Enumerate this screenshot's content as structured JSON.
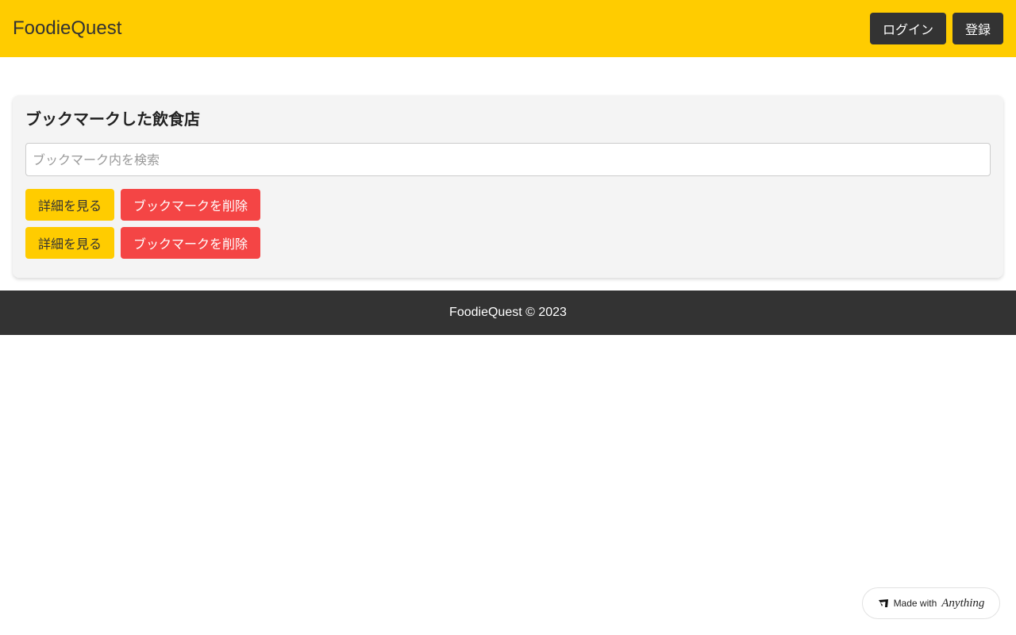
{
  "header": {
    "brand": "FoodieQuest",
    "login_label": "ログイン",
    "register_label": "登録",
    "background_color": "#ffcc00"
  },
  "bookmarks": {
    "title": "ブックマークした飲食店",
    "search_placeholder": "ブックマーク内を検索",
    "search_value": "",
    "rows": [
      {
        "view_label": "詳細を見る",
        "remove_label": "ブックマークを削除"
      },
      {
        "view_label": "詳細を見る",
        "remove_label": "ブックマークを削除"
      }
    ]
  },
  "footer": {
    "text": "FoodieQuest © 2023"
  },
  "badge": {
    "prefix": "Made with",
    "brand": "Anything",
    "icon": "anything-logo-icon"
  },
  "colors": {
    "accent": "#ffcc00",
    "danger": "#f44545",
    "dark": "#333333"
  }
}
